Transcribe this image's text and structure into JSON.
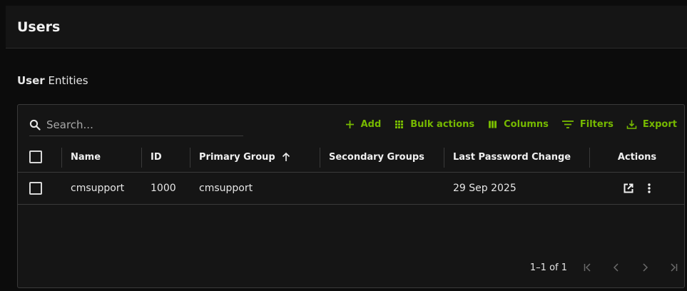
{
  "page": {
    "title": "Users"
  },
  "section": {
    "title_bold": "User",
    "title_rest": "Entities"
  },
  "search": {
    "placeholder": "Search..."
  },
  "toolbar": {
    "add": "Add",
    "bulk": "Bulk actions",
    "columns": "Columns",
    "filters": "Filters",
    "export": "Export"
  },
  "table": {
    "headers": {
      "name": "Name",
      "id": "ID",
      "primary_group": "Primary Group",
      "secondary_groups": "Secondary Groups",
      "last_password_change": "Last Password Change",
      "actions": "Actions"
    },
    "sort": {
      "column": "Primary Group",
      "direction": "ascending"
    },
    "rows": [
      {
        "name": "cmsupport",
        "id": "1000",
        "primary_group": "cmsupport",
        "secondary_groups": "",
        "last_password_change": "29 Sep 2025"
      }
    ]
  },
  "pagination": {
    "range_text": "1–1 of 1"
  },
  "icons": {
    "search": "search-icon",
    "add": "plus-icon",
    "bulk": "grid-dots-icon",
    "columns": "columns-icon",
    "filters": "filter-lines-icon",
    "export": "download-icon",
    "sort": "arrow-up-icon",
    "open": "open-external-icon",
    "more": "more-vertical-icon"
  },
  "colors": {
    "accent": "#76b900",
    "background": "#0c0c0c",
    "panel": "#151515"
  }
}
